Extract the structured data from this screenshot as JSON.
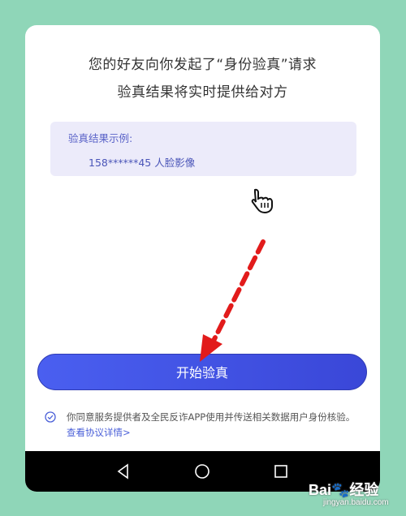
{
  "header": {
    "line1": "您的好友向你发起了“身份验真”请求",
    "line2": "验真结果将实时提供给对方"
  },
  "example": {
    "label": "验真结果示例:",
    "value": "158******45 人脸影像"
  },
  "start_button": {
    "label": "开始验真"
  },
  "agreement": {
    "text": "你同意服务提供者及全民反诈APP使用并传送相关数据用户身份核验。",
    "link": "查看协议详情>"
  },
  "watermark": {
    "logo": "Bai🐾经验",
    "url": "jingyan.baidu.com"
  },
  "colors": {
    "accent": "#4354e6",
    "background": "#8fd6b8",
    "arrow": "#e21b1b"
  },
  "icons": [
    "check-circle-icon",
    "back-triangle-icon",
    "home-circle-icon",
    "recent-square-icon",
    "hand-cursor-icon"
  ]
}
